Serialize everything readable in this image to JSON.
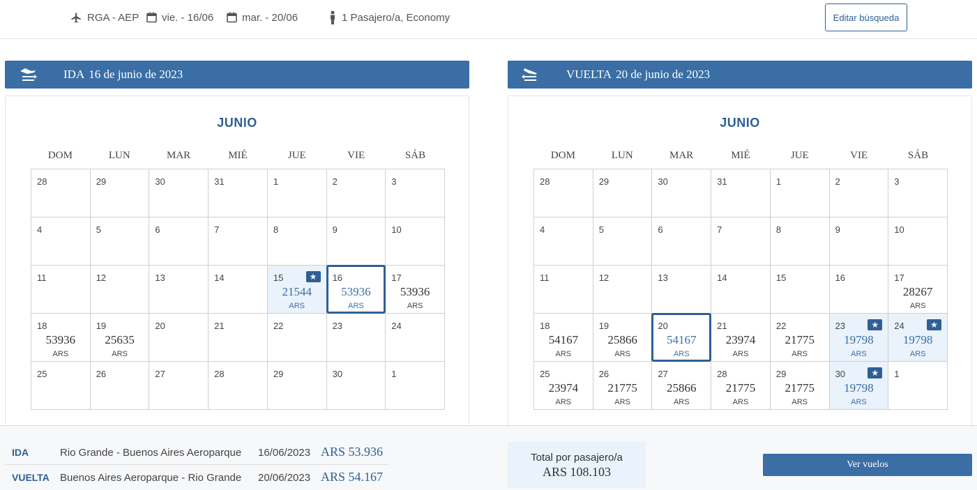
{
  "search": {
    "route": "RGA - AEP",
    "depart": "vie. - 16/06",
    "return": "mar. - 20/06",
    "passengers": "1 Pasajero/a, Economy",
    "edit_label": "Editar búsqueda"
  },
  "days_of_week": [
    "DOM",
    "LUN",
    "MAR",
    "MIÉ",
    "JUE",
    "VIE",
    "SÁB"
  ],
  "outbound": {
    "label": "IDA",
    "date": "16 de junio de 2023",
    "month": "JUNIO",
    "cells": [
      {
        "d": "28"
      },
      {
        "d": "29"
      },
      {
        "d": "30"
      },
      {
        "d": "31"
      },
      {
        "d": "1"
      },
      {
        "d": "2"
      },
      {
        "d": "3"
      },
      {
        "d": "4"
      },
      {
        "d": "5"
      },
      {
        "d": "6"
      },
      {
        "d": "7"
      },
      {
        "d": "8"
      },
      {
        "d": "9"
      },
      {
        "d": "10"
      },
      {
        "d": "11"
      },
      {
        "d": "12"
      },
      {
        "d": "13"
      },
      {
        "d": "14"
      },
      {
        "d": "15",
        "price": "21544",
        "cur": "ARS",
        "promo": true
      },
      {
        "d": "16",
        "price": "53936",
        "cur": "ARS",
        "selected": true
      },
      {
        "d": "17",
        "price": "53936",
        "cur": "ARS"
      },
      {
        "d": "18",
        "price": "53936",
        "cur": "ARS"
      },
      {
        "d": "19",
        "price": "25635",
        "cur": "ARS"
      },
      {
        "d": "20"
      },
      {
        "d": "21"
      },
      {
        "d": "22"
      },
      {
        "d": "23"
      },
      {
        "d": "24"
      },
      {
        "d": "25"
      },
      {
        "d": "26"
      },
      {
        "d": "27"
      },
      {
        "d": "28"
      },
      {
        "d": "29"
      },
      {
        "d": "30"
      },
      {
        "d": "1"
      }
    ]
  },
  "inbound": {
    "label": "VUELTA",
    "date": "20 de junio de 2023",
    "month": "JUNIO",
    "cells": [
      {
        "d": "28"
      },
      {
        "d": "29"
      },
      {
        "d": "30"
      },
      {
        "d": "31"
      },
      {
        "d": "1"
      },
      {
        "d": "2"
      },
      {
        "d": "3"
      },
      {
        "d": "4"
      },
      {
        "d": "5"
      },
      {
        "d": "6"
      },
      {
        "d": "7"
      },
      {
        "d": "8"
      },
      {
        "d": "9"
      },
      {
        "d": "10"
      },
      {
        "d": "11"
      },
      {
        "d": "12"
      },
      {
        "d": "13"
      },
      {
        "d": "14"
      },
      {
        "d": "15"
      },
      {
        "d": "16"
      },
      {
        "d": "17",
        "price": "28267",
        "cur": "ARS"
      },
      {
        "d": "18",
        "price": "54167",
        "cur": "ARS"
      },
      {
        "d": "19",
        "price": "25866",
        "cur": "ARS"
      },
      {
        "d": "20",
        "price": "54167",
        "cur": "ARS",
        "selected": true
      },
      {
        "d": "21",
        "price": "23974",
        "cur": "ARS"
      },
      {
        "d": "22",
        "price": "21775",
        "cur": "ARS"
      },
      {
        "d": "23",
        "price": "19798",
        "cur": "ARS",
        "promo": true
      },
      {
        "d": "24",
        "price": "19798",
        "cur": "ARS",
        "promo": true
      },
      {
        "d": "25",
        "price": "23974",
        "cur": "ARS"
      },
      {
        "d": "26",
        "price": "21775",
        "cur": "ARS"
      },
      {
        "d": "27",
        "price": "25866",
        "cur": "ARS"
      },
      {
        "d": "28",
        "price": "21775",
        "cur": "ARS"
      },
      {
        "d": "29",
        "price": "21775",
        "cur": "ARS"
      },
      {
        "d": "30",
        "price": "19798",
        "cur": "ARS",
        "promo": true
      },
      {
        "d": "1"
      }
    ]
  },
  "summary": {
    "rows": [
      {
        "label": "IDA",
        "route": "Rio Grande - Buenos Aires Aeroparque",
        "date": "16/06/2023",
        "amount": "ARS 53.936"
      },
      {
        "label": "VUELTA",
        "route": "Buenos Aires Aeroparque - Rio Grande",
        "date": "20/06/2023",
        "amount": "ARS 54.167"
      }
    ],
    "total_label": "Total por pasajero/a",
    "total_value": "ARS 108.103",
    "button_label": "Ver vuelos"
  },
  "colors": {
    "primary": "#3a6ea5",
    "primary_dark": "#2e5f96",
    "promo_bg": "#eaf2fb"
  },
  "icons": {
    "route": "plane-icon",
    "date": "calendar-icon",
    "passenger": "person-icon",
    "promo": "star-ticket-icon",
    "outbound": "departure-icon",
    "inbound": "arrival-icon"
  }
}
